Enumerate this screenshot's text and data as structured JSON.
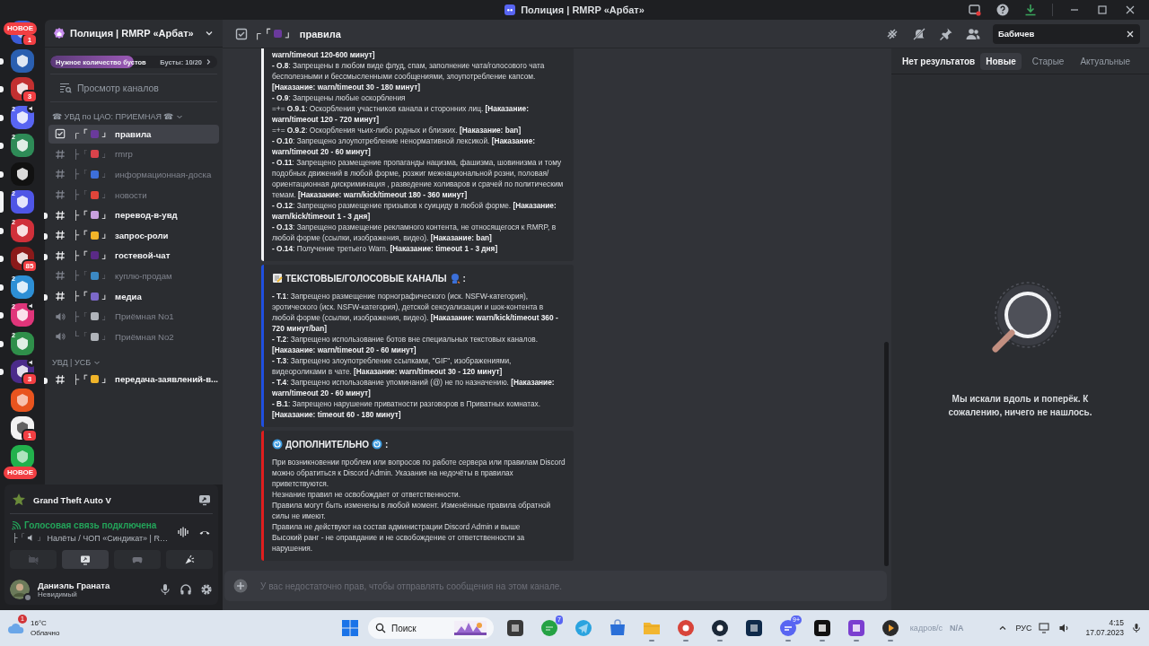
{
  "window": {
    "title": "Полиция | RMRP «Арбат»"
  },
  "servers": [
    {
      "color": "#3b5bd6",
      "badge": "1",
      "unread": false,
      "selected": false
    },
    {
      "color": "#2a5fb0",
      "unread": true,
      "selected": false
    },
    {
      "color": "#c23030",
      "badge": "3",
      "unread": true,
      "selected": false
    },
    {
      "color": "#5865f2",
      "users": "2",
      "speaker": true,
      "unread": true,
      "selected": false
    },
    {
      "color": "#2e8b57",
      "users": "2",
      "unread": true,
      "selected": false
    },
    {
      "color": "#111111",
      "unread": true,
      "selected": false
    },
    {
      "color": "#4f56e6",
      "users": "2",
      "unread": false,
      "selected": true
    },
    {
      "color": "#d0303a",
      "users": "2",
      "unread": true,
      "selected": false
    },
    {
      "color": "#8b1a1a",
      "badge": "85",
      "unread": true,
      "selected": false
    },
    {
      "color": "#2d8fd5",
      "users": "2",
      "unread": true,
      "selected": false
    },
    {
      "color": "#e0357a",
      "users": "2",
      "speaker": true,
      "unread": true,
      "selected": false
    },
    {
      "color": "#2f8f4a",
      "users": "2",
      "unread": true,
      "selected": false
    },
    {
      "color": "#4b2b8a",
      "badge": "3",
      "speaker": true,
      "unread": true,
      "selected": false
    },
    {
      "color": "#e8541e",
      "unread": false,
      "selected": false
    },
    {
      "color": "#f2f2f2",
      "badge": "1",
      "unread": false,
      "selected": false
    },
    {
      "color": "#22b14c",
      "unread": false,
      "selected": false
    }
  ],
  "new_labels": [
    "НОВОЕ",
    "НОВОЕ"
  ],
  "server": {
    "name": "Полиция | RMRP «Арбат»",
    "boost_label": "Нужное количество бустов",
    "boost_count": "Бусты: 10/20",
    "level": 0.5,
    "browse": "Просмотр каналов"
  },
  "categories": [
    {
      "name": "☎ УВД по ЦАО: ПРИЕМНАЯ ☎",
      "channels": [
        {
          "kind": "rules",
          "prefix": "┌「",
          "color": "#6a3a9c",
          "suffix": "」",
          "name": "правила",
          "unread": false,
          "selected": true
        },
        {
          "kind": "text",
          "prefix": "├「",
          "color": "#d8434b",
          "suffix": "」",
          "name": "rmrp",
          "unread": false,
          "selected": false
        },
        {
          "kind": "text",
          "prefix": "├「",
          "color": "#3d6fd8",
          "suffix": "」",
          "name": "информационная-доска",
          "unread": false,
          "selected": false
        },
        {
          "kind": "text",
          "prefix": "├「",
          "color": "#e0453a",
          "suffix": "」",
          "name": "новости",
          "unread": false,
          "selected": false
        },
        {
          "kind": "text",
          "prefix": "├「",
          "color": "#c9a0e0",
          "suffix": "」",
          "name": "перевод-в-увд",
          "unread": true,
          "selected": false
        },
        {
          "kind": "text",
          "prefix": "├「",
          "color": "#f0b429",
          "suffix": "」",
          "name": "запрос-роли",
          "unread": true,
          "selected": false
        },
        {
          "kind": "text",
          "prefix": "├「",
          "color": "#5a2a86",
          "suffix": "」",
          "name": "гостевой-чат",
          "unread": true,
          "selected": false
        },
        {
          "kind": "text",
          "prefix": "├「",
          "color": "#3b88c3",
          "suffix": "」",
          "name": "куплю-продам",
          "unread": false,
          "selected": false
        },
        {
          "kind": "text",
          "prefix": "├「",
          "color": "#7b68c8",
          "suffix": "」",
          "name": "медиа",
          "unread": true,
          "selected": false
        },
        {
          "kind": "voice",
          "prefix": "├「",
          "color": "#b0b4ba",
          "suffix": "」",
          "name": "Приёмная No1",
          "unread": false,
          "selected": false
        },
        {
          "kind": "voice",
          "prefix": "└「",
          "color": "#b0b4ba",
          "suffix": "」",
          "name": "Приёмная No2",
          "unread": false,
          "selected": false
        }
      ]
    },
    {
      "name": "УВД | УСБ",
      "channels": [
        {
          "kind": "text",
          "prefix": "├「",
          "color": "#f0b429",
          "suffix": "」",
          "name": "передача-заявлений-в...",
          "unread": true,
          "selected": false
        }
      ]
    }
  ],
  "activity": {
    "game": "Grand Theft Auto V"
  },
  "voice": {
    "status": "Голосовая связь подключена",
    "prefix": "├「",
    "suffix": "」",
    "channel": "Налёты / ЧОП «Синдикат» | R…"
  },
  "user": {
    "name": "Даниэль Граната",
    "status": "Невидимый"
  },
  "channel_header": {
    "prefix": "┌「",
    "color": "#6a3a9c",
    "suffix": "」",
    "name": "правила"
  },
  "search": {
    "value": "Бабичев"
  },
  "messages": [
    {
      "color": "#f2f3f5",
      "paragraphs": [
        "**warn/timeout 120-600 минут]**",
        "**- O.8**: Запрещены в любом виде флуд, спам, заполнение чата/голосового чата бесполезными и бессмысленными сообщениями, злоупотребление капсом. **[Наказание: warn/timeout 30 - 180 минут]**",
        "**- O.9**: Запрещены любые оскорбления",
        "=+= **O.9.1**: Оскорбления участников канала и сторонних лиц. **[Наказание: warn/timeout 120 - 720 минут]**",
        "=+= **O.9.2**: Оскорбления чьих-либо родных и близких. **[Наказание: ban]**",
        "**- O.10**: Запрещено злоупотребление ненормативной лексикой. **[Наказание: warn/timeout 20 - 60 минут]**",
        "**- O.11**: Запрещено размещение пропаганды нацизма, фашизма, шовинизма и тому подобных движений в любой форме, розжиг межнациональной розни, половая/ориентационная дискриминация , разведение холиваров и срачей по политическим темам. **[Наказание: warn/kick/timeout 180 - 360 минут]**",
        "**- O.12**: Запрещено размещение призывов к суициду в любой форме. **[Наказание: warn/kick/timeout 1 - 3 дня]**",
        "**- O.13**: Запрещено размещение рекламного контента, не относящегося к RMRP, в любой форме (ссылки, изображения, видео). **[Наказание: ban]**",
        "**- O.14**: Получение третьего Warn. **[Наказание: timeout 1 - 3 дня]**"
      ]
    },
    {
      "color": "#1f4fe0",
      "title": "ТЕКСТОВЫЕ/ГОЛОСОВЫЕ КАНАЛЫ",
      "title_icons": [
        {
          "kind": "memo"
        },
        {
          "kind": "head"
        }
      ],
      "title_end": ":",
      "paragraphs": [
        "**- T.1**: Запрещено размещение порнографического (иск. NSFW-категория), эротического (иск. NSFW-категория), детской сексуализации и шок-контента в любой форме (ссылки, изображения, видео). **[Наказание: warn/kick/timeout 360 - 720 минут/ban]**",
        "**- T.2**: Запрещено использование ботов вне специальных текстовых каналов. **[Наказание: warn/timeout 20 - 60 минут]**",
        "**- T.3**: Запрещено злоупотребление ссылками, \"GIF\", изображениями, видеороликами в чате. **[Наказание: warn/timeout 30 - 120 минут]**",
        "**- T.4**: Запрещено использование упоминаний (@) не по назначению. **[Наказание: warn/timeout 20 - 60 минут]**",
        "**- B.1**: Запрещено нарушение приватности разговоров в Приватных комнатах. **[Наказание: timeout 60 - 180 минут]**"
      ]
    },
    {
      "color": "#e01e1e",
      "title": "ДОПОЛНИТЕЛЬНО",
      "title_icons": [
        {
          "kind": "cyclone"
        },
        {
          "kind": "cyclone"
        }
      ],
      "title_end": ":",
      "paragraphs": [
        "При возникновении проблем или вопросов по работе сервера или правилам Discord можно обратиться к Discord Admin. Указания на недочёты в правилах приветствуются.",
        "Незнание правил не освобождает от ответственности.",
        "Правила могут быть изменены в любой момент. Изменённые правила обратной силы не имеют.",
        "Правила не действуют на состав администрации Discord Admin и выше",
        "Высокий ранг - не оправдание и не освобождение от ответственности за нарушения."
      ]
    }
  ],
  "composer": {
    "placeholder": "У вас недостаточно прав, чтобы отправлять сообщения на этом канале."
  },
  "results": {
    "summary": "Нет результатов",
    "tabs": [
      {
        "label": "Новые",
        "selected": true
      },
      {
        "label": "Старые",
        "selected": false
      },
      {
        "label": "Актуальные",
        "selected": false
      }
    ],
    "empty_text": "Мы искали вдоль и поперёк. К сожалению, ничего не нашлось."
  },
  "taskbar": {
    "temp": "16°C",
    "condition": "Облачно",
    "weather_badge": "1",
    "search_placeholder": "Поиск",
    "apps": [
      {
        "kind": "squares",
        "color": "#3a3a3a",
        "running": false
      },
      {
        "kind": "bubble",
        "color": "#25a244",
        "badge": "7",
        "running": false
      },
      {
        "kind": "plane",
        "color": "#2aa3df",
        "running": false
      },
      {
        "kind": "bag",
        "color": "#2a6fd8",
        "running": false
      },
      {
        "kind": "folder",
        "color": "#f2b630",
        "running": true
      },
      {
        "kind": "ring",
        "color": "#d8443a",
        "running": true
      },
      {
        "kind": "ring",
        "color": "#1b2838",
        "running": true
      },
      {
        "kind": "squares",
        "color": "#0f2a4a",
        "running": false
      },
      {
        "kind": "bubble",
        "color": "#5865f2",
        "badge": "9+",
        "running": true
      },
      {
        "kind": "squares",
        "color": "#111111",
        "running": true
      },
      {
        "kind": "squares",
        "color": "#7b3fd0",
        "running": true
      },
      {
        "kind": "play",
        "color": "#2b2b2b",
        "running": true
      }
    ],
    "fps_label": "кадров/с",
    "fps_value": "N/A",
    "language": "РУС",
    "time": "4:15",
    "date": "17.07.2023"
  }
}
